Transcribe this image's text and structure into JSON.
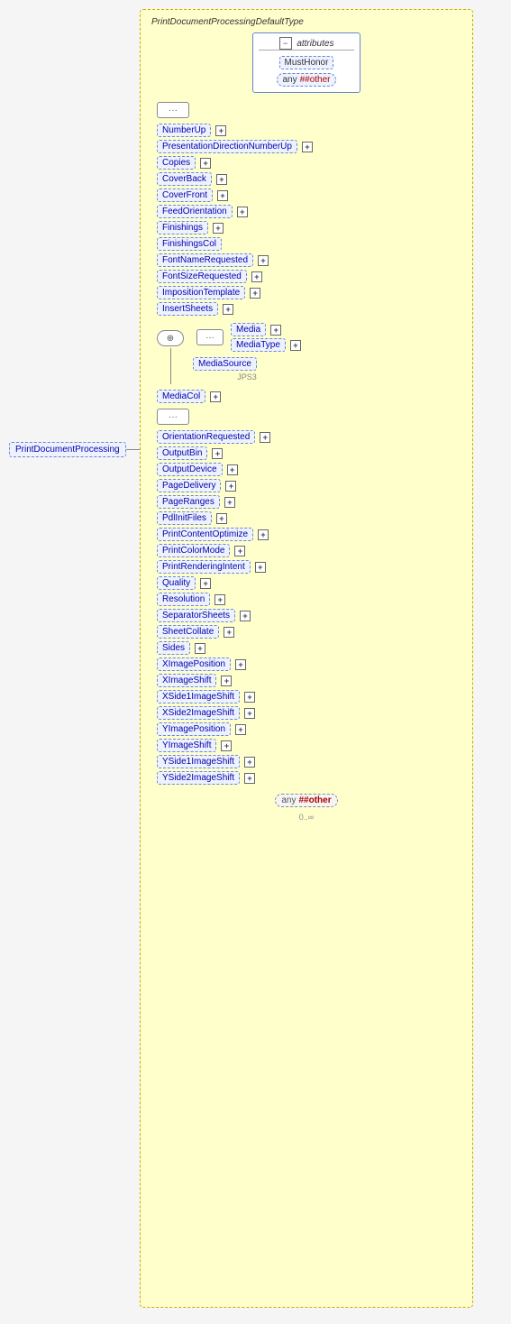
{
  "diagram": {
    "outer_element": {
      "label": "PrintDocumentProcessing",
      "expand_icon": "+"
    },
    "main_box": {
      "title": "PrintDocumentProcessingDefaultType",
      "attributes_section": {
        "label": "attributes",
        "items": [
          {
            "text": "MustHonor",
            "style": "dashed"
          },
          {
            "text": "any",
            "prefix": "",
            "suffix": " ##other",
            "style": "dashed-rounded"
          }
        ]
      },
      "connector1": "···",
      "elements": [
        {
          "name": "NumberUp",
          "has_expand": true,
          "indent": 0
        },
        {
          "name": "PresentationDirectionNumberUp",
          "has_expand": true,
          "indent": 0
        },
        {
          "name": "Copies",
          "has_expand": true,
          "indent": 0
        },
        {
          "name": "CoverBack",
          "has_expand": true,
          "indent": 0
        },
        {
          "name": "CoverFront",
          "has_expand": true,
          "indent": 0
        },
        {
          "name": "FeedOrientation",
          "has_expand": true,
          "indent": 0
        },
        {
          "name": "Finishings",
          "has_expand": true,
          "indent": 0
        },
        {
          "name": "FinishingsCol",
          "has_expand": false,
          "indent": 0
        },
        {
          "name": "FontNameRequested",
          "has_expand": true,
          "indent": 0
        },
        {
          "name": "FontSizeRequested",
          "has_expand": true,
          "indent": 0
        },
        {
          "name": "ImpositionTemplate",
          "has_expand": true,
          "indent": 0
        },
        {
          "name": "InsertSheets",
          "has_expand": true,
          "indent": 0
        }
      ],
      "media_section": {
        "choice_connector": "⊕",
        "seq_connector": "···",
        "media_group": {
          "seq_inner": "···",
          "items": [
            {
              "name": "Media",
              "has_expand": true
            },
            {
              "name": "MediaType",
              "has_expand": true
            }
          ]
        },
        "media_source": {
          "name": "MediaSource",
          "has_expand": false
        },
        "jp53_label": "JPS3",
        "media_col": {
          "name": "MediaCol",
          "has_expand": true
        }
      },
      "connector2": "···",
      "elements2": [
        {
          "name": "OrientationRequested",
          "has_expand": true,
          "indent": 0
        },
        {
          "name": "OutputBin",
          "has_expand": true,
          "indent": 0
        },
        {
          "name": "OutputDevice",
          "has_expand": true,
          "indent": 0
        },
        {
          "name": "PageDelivery",
          "has_expand": true,
          "indent": 0
        },
        {
          "name": "PageRanges",
          "has_expand": true,
          "indent": 0
        },
        {
          "name": "PdlInitFiles",
          "has_expand": true,
          "indent": 0
        },
        {
          "name": "PrintContentOptimize",
          "has_expand": true,
          "indent": 0
        },
        {
          "name": "PrintColorMode",
          "has_expand": true,
          "indent": 0
        },
        {
          "name": "PrintRenderingIntent",
          "has_expand": true,
          "indent": 0
        },
        {
          "name": "Quality",
          "has_expand": true,
          "indent": 0
        },
        {
          "name": "Resolution",
          "has_expand": true,
          "indent": 0
        },
        {
          "name": "SeparatorSheets",
          "has_expand": true,
          "indent": 0
        },
        {
          "name": "SheetCollate",
          "has_expand": true,
          "indent": 0
        },
        {
          "name": "Sides",
          "has_expand": true,
          "indent": 0
        },
        {
          "name": "XImagePosition",
          "has_expand": true,
          "indent": 0
        },
        {
          "name": "XImageShift",
          "has_expand": true,
          "indent": 0
        },
        {
          "name": "XSide1ImageShift",
          "has_expand": true,
          "indent": 0
        },
        {
          "name": "XSide2ImageShift",
          "has_expand": true,
          "indent": 0
        },
        {
          "name": "YImagePosition",
          "has_expand": true,
          "indent": 0
        },
        {
          "name": "YImageShift",
          "has_expand": true,
          "indent": 0
        },
        {
          "name": "YSide1ImageShift",
          "has_expand": true,
          "indent": 0
        },
        {
          "name": "YSide2ImageShift",
          "has_expand": true,
          "indent": 0
        }
      ],
      "footer": {
        "any_label": "any",
        "any_suffix": " ##other",
        "cardinality": "0..∞"
      }
    }
  }
}
